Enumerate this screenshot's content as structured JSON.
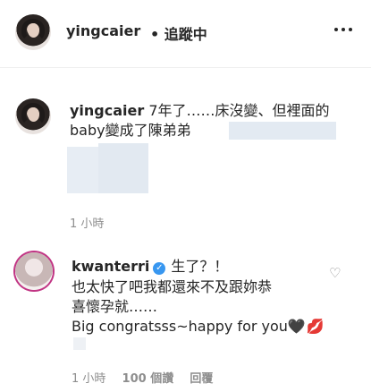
{
  "header": {
    "username": "yingcaier",
    "follow_label": "• 追蹤中"
  },
  "caption": {
    "username": "yingcaier",
    "text_line1": "7年了……床沒變、但裡面的",
    "text_line2": "baby變成了陳弟弟",
    "time": "1 小時"
  },
  "comment": {
    "username": "kwanterri",
    "text_line1": "生了？！",
    "text_line2": "也太快了吧我都還來不及跟妳恭",
    "text_line3": "喜懷孕就……",
    "text_line4": "Big congratsss~happy for you",
    "emoji": "🖤💋",
    "time": "1 小時",
    "likes": "100 個讚",
    "reply_label": "回覆"
  },
  "icons": [
    "more-icon",
    "verified-icon",
    "heart-icon"
  ],
  "colors": {
    "text": "#262626",
    "muted": "#8e8e8e",
    "verified": "#3897f0"
  }
}
